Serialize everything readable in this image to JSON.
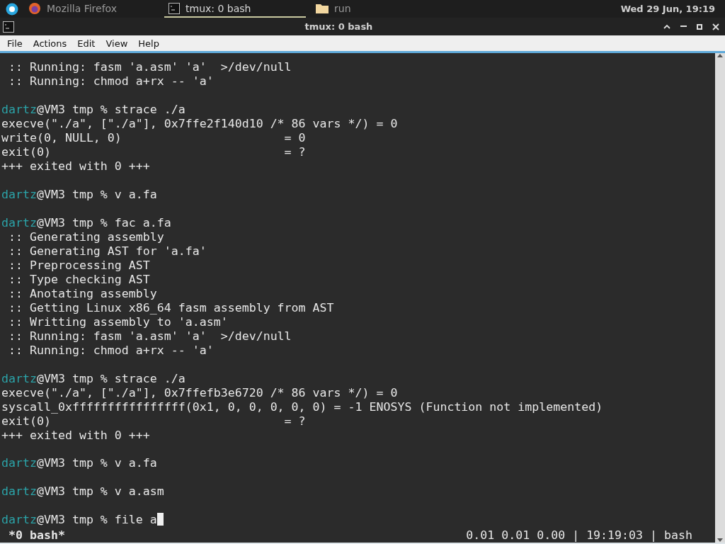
{
  "panel": {
    "apps": [
      {
        "label": "Mozilla Firefox",
        "kind": "firefox",
        "selected": false
      },
      {
        "label": "tmux: 0 bash",
        "kind": "terminal",
        "selected": true
      },
      {
        "label": "run",
        "kind": "folder",
        "selected": false
      }
    ],
    "clock": "Wed 29 Jun, 19:19"
  },
  "window": {
    "title": "tmux: 0 bash"
  },
  "menu": [
    "File",
    "Actions",
    "Edit",
    "View",
    "Help"
  ],
  "terminal": {
    "lines": [
      {
        "kind": "output",
        "text": " :: Running: fasm 'a.asm' 'a'  >/dev/null"
      },
      {
        "kind": "output",
        "text": " :: Running: chmod a+rx -- 'a'"
      },
      {
        "kind": "blank"
      },
      {
        "kind": "prompt",
        "user": "dartz",
        "text": "@VM3 tmp % strace ./a"
      },
      {
        "kind": "output",
        "text": "execve(\"./a\", [\"./a\"], 0x7ffe2f140d10 /* 86 vars */) = 0"
      },
      {
        "kind": "output",
        "text": "write(0, NULL, 0)                       = 0"
      },
      {
        "kind": "output",
        "text": "exit(0)                                 = ?"
      },
      {
        "kind": "output",
        "text": "+++ exited with 0 +++"
      },
      {
        "kind": "blank"
      },
      {
        "kind": "prompt",
        "user": "dartz",
        "text": "@VM3 tmp % v a.fa"
      },
      {
        "kind": "blank"
      },
      {
        "kind": "prompt",
        "user": "dartz",
        "text": "@VM3 tmp % fac a.fa"
      },
      {
        "kind": "output",
        "text": " :: Generating assembly"
      },
      {
        "kind": "output",
        "text": " :: Generating AST for 'a.fa'"
      },
      {
        "kind": "output",
        "text": " :: Preprocessing AST"
      },
      {
        "kind": "output",
        "text": " :: Type checking AST"
      },
      {
        "kind": "output",
        "text": " :: Anotating assembly"
      },
      {
        "kind": "output",
        "text": " :: Getting Linux x86_64 fasm assembly from AST"
      },
      {
        "kind": "output",
        "text": " :: Writting assembly to 'a.asm'"
      },
      {
        "kind": "output",
        "text": " :: Running: fasm 'a.asm' 'a'  >/dev/null"
      },
      {
        "kind": "output",
        "text": " :: Running: chmod a+rx -- 'a'"
      },
      {
        "kind": "blank"
      },
      {
        "kind": "prompt",
        "user": "dartz",
        "text": "@VM3 tmp % strace ./a"
      },
      {
        "kind": "output",
        "text": "execve(\"./a\", [\"./a\"], 0x7ffefb3e6720 /* 86 vars */) = 0"
      },
      {
        "kind": "output",
        "text": "syscall_0xffffffffffffffff(0x1, 0, 0, 0, 0, 0) = -1 ENOSYS (Function not implemented)"
      },
      {
        "kind": "output",
        "text": "exit(0)                                 = ?"
      },
      {
        "kind": "output",
        "text": "+++ exited with 0 +++"
      },
      {
        "kind": "blank"
      },
      {
        "kind": "prompt",
        "user": "dartz",
        "text": "@VM3 tmp % v a.fa"
      },
      {
        "kind": "blank"
      },
      {
        "kind": "prompt",
        "user": "dartz",
        "text": "@VM3 tmp % v a.asm"
      },
      {
        "kind": "blank"
      },
      {
        "kind": "prompt",
        "user": "dartz",
        "text": "@VM3 tmp % file a",
        "cursor": true
      }
    ],
    "status": {
      "left": "*0 bash*",
      "right": "0.01 0.01 0.00 | 19:19:03 | bash"
    }
  }
}
